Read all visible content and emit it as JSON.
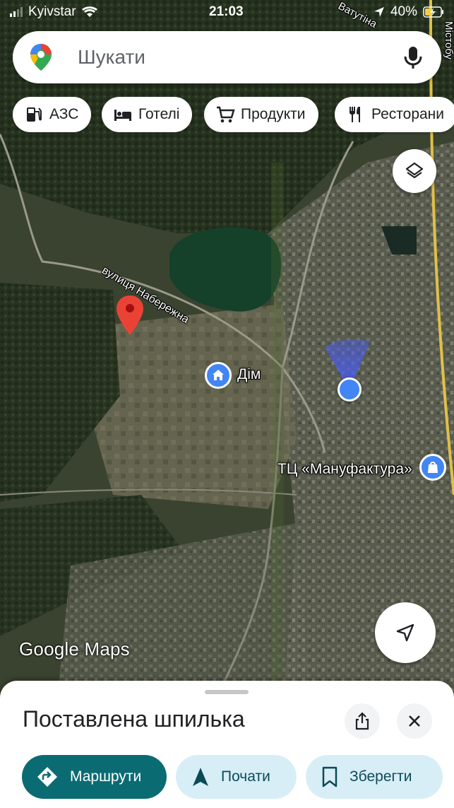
{
  "status_bar": {
    "carrier": "Kyivstar",
    "time": "21:03",
    "battery": "40%"
  },
  "search": {
    "placeholder": "Шукати"
  },
  "chips": [
    {
      "label": "АЗС",
      "icon": "gas-station-icon"
    },
    {
      "label": "Готелі",
      "icon": "hotel-bed-icon"
    },
    {
      "label": "Продукти",
      "icon": "shopping-cart-icon"
    },
    {
      "label": "Ресторани",
      "icon": "restaurant-icon"
    }
  ],
  "map": {
    "streets": {
      "naberezhna": "вулиця Набережна",
      "vatutina": "Ватутіна",
      "right_edge": "Містобу"
    },
    "places": {
      "home": "Дім",
      "mall": "ТЦ «Мануфактура»"
    },
    "attribution": "Google Maps"
  },
  "sheet": {
    "title": "Поставлена шпилька",
    "actions": {
      "directions": "Маршрути",
      "start": "Почати",
      "save": "Зберегти"
    }
  },
  "colors": {
    "primary_action": "#0b6b73",
    "secondary_action": "#d7eef7",
    "location_blue": "#4285f4",
    "pin_red": "#ea4335"
  }
}
